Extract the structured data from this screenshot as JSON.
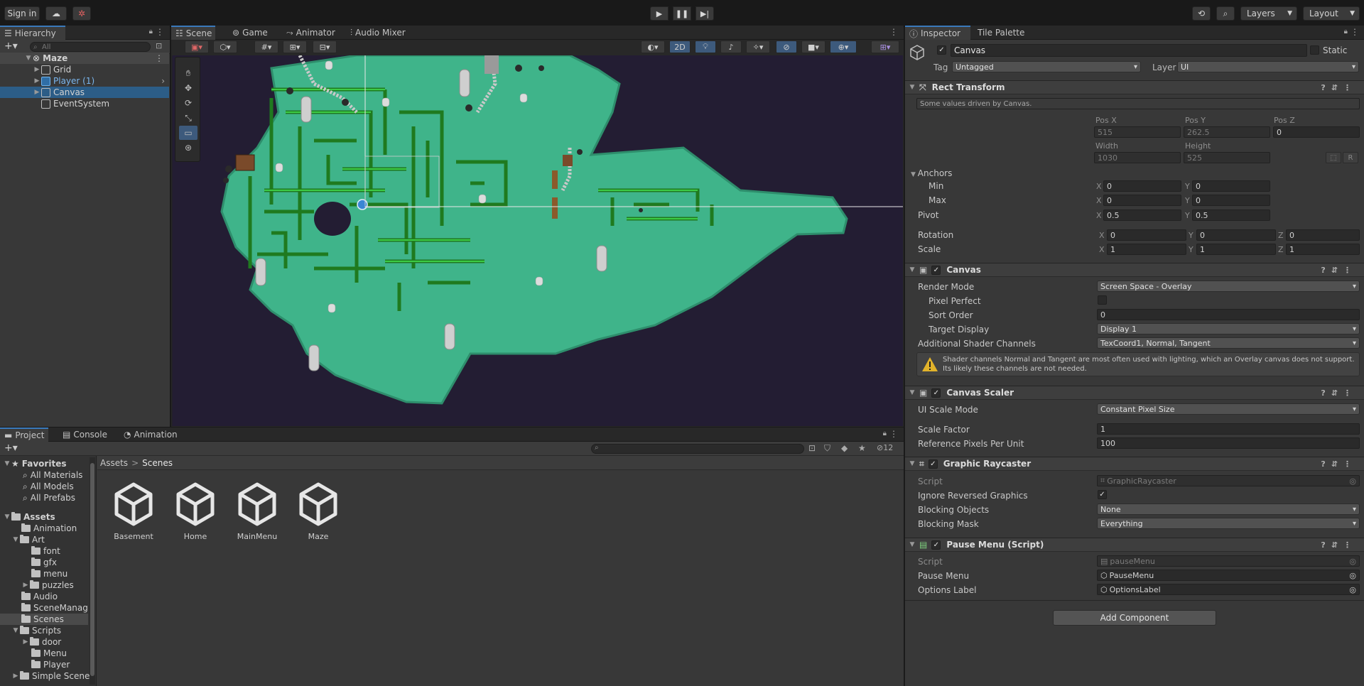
{
  "toolbar": {
    "signin_label": "Sign in",
    "layers_label": "Layers",
    "layout_label": "Layout"
  },
  "hierarchy": {
    "tab_label": "Hierarchy",
    "search_placeholder": "All",
    "root": "Maze",
    "items": [
      {
        "label": "Grid"
      },
      {
        "label": "Player (1)"
      },
      {
        "label": "Canvas"
      },
      {
        "label": "EventSystem"
      }
    ]
  },
  "scene_tabs": {
    "scene": "Scene",
    "game": "Game",
    "animator": "Animator",
    "audio_mixer": "Audio Mixer",
    "mode_2d": "2D"
  },
  "inspector": {
    "tab_label": "Inspector",
    "tile_palette_label": "Tile Palette",
    "object_name": "Canvas",
    "static_label": "Static",
    "tag_label": "Tag",
    "tag_value": "Untagged",
    "layer_label": "Layer",
    "layer_value": "UI",
    "rect_transform": {
      "title": "Rect Transform",
      "note": "Some values driven by Canvas.",
      "pos_x_label": "Pos X",
      "pos_x": "515",
      "pos_y_label": "Pos Y",
      "pos_y": "262.5",
      "pos_z_label": "Pos Z",
      "pos_z": "0",
      "width_label": "Width",
      "width": "1030",
      "height_label": "Height",
      "height": "525",
      "anchors_label": "Anchors",
      "min_label": "Min",
      "min_x": "0",
      "min_y": "0",
      "max_label": "Max",
      "max_x": "0",
      "max_y": "0",
      "pivot_label": "Pivot",
      "pivot_x": "0.5",
      "pivot_y": "0.5",
      "rotation_label": "Rotation",
      "rot_x": "0",
      "rot_y": "0",
      "rot_z": "0",
      "scale_label": "Scale",
      "scale_x": "1",
      "scale_y": "1",
      "scale_z": "1",
      "r_label": "R"
    },
    "canvas": {
      "title": "Canvas",
      "render_mode_label": "Render Mode",
      "render_mode": "Screen Space - Overlay",
      "pixel_perfect_label": "Pixel Perfect",
      "sort_order_label": "Sort Order",
      "sort_order": "0",
      "target_display_label": "Target Display",
      "target_display": "Display 1",
      "shader_channels_label": "Additional Shader Channels",
      "shader_channels": "TexCoord1, Normal, Tangent",
      "warning": "Shader channels Normal and Tangent are most often used with lighting, which an Overlay canvas does not support. Its likely these channels are not needed."
    },
    "canvas_scaler": {
      "title": "Canvas Scaler",
      "ui_scale_mode_label": "UI Scale Mode",
      "ui_scale_mode": "Constant Pixel Size",
      "scale_factor_label": "Scale Factor",
      "scale_factor": "1",
      "ref_ppu_label": "Reference Pixels Per Unit",
      "ref_ppu": "100"
    },
    "graphic_raycaster": {
      "title": "Graphic Raycaster",
      "script_label": "Script",
      "script": "GraphicRaycaster",
      "ignore_reversed_label": "Ignore Reversed Graphics",
      "blocking_objects_label": "Blocking Objects",
      "blocking_objects": "None",
      "blocking_mask_label": "Blocking Mask",
      "blocking_mask": "Everything"
    },
    "pause_menu": {
      "title": "Pause Menu (Script)",
      "script_label": "Script",
      "script": "pauseMenu",
      "pause_menu_label": "Pause Menu",
      "pause_menu": "PauseMenu",
      "options_label_label": "Options Label",
      "options_label": "OptionsLabel"
    },
    "add_component": "Add Component"
  },
  "project": {
    "tab_project": "Project",
    "tab_console": "Console",
    "tab_animation": "Animation",
    "hidden_count": "12",
    "favorites_label": "Favorites",
    "favorites": [
      "All Materials",
      "All Models",
      "All Prefabs"
    ],
    "assets_label": "Assets",
    "tree": [
      {
        "label": "Animation"
      },
      {
        "label": "Art"
      },
      {
        "label": "font"
      },
      {
        "label": "gfx"
      },
      {
        "label": "menu"
      },
      {
        "label": "puzzles"
      },
      {
        "label": "Audio"
      },
      {
        "label": "SceneManag"
      },
      {
        "label": "Scenes"
      },
      {
        "label": "Scripts"
      },
      {
        "label": "door"
      },
      {
        "label": "Menu"
      },
      {
        "label": "Player"
      },
      {
        "label": "Simple Scene"
      }
    ],
    "breadcrumb_root": "Assets",
    "breadcrumb_sep": ">",
    "breadcrumb_current": "Scenes",
    "assets": [
      "Basement",
      "Home",
      "MainMenu",
      "Maze"
    ]
  },
  "colors": {
    "accent": "#3a79bb",
    "selection": "#2c5d87",
    "map_grass": "#3fb48a",
    "map_bg": "#231d33",
    "hedge": "#2c8a2c"
  }
}
